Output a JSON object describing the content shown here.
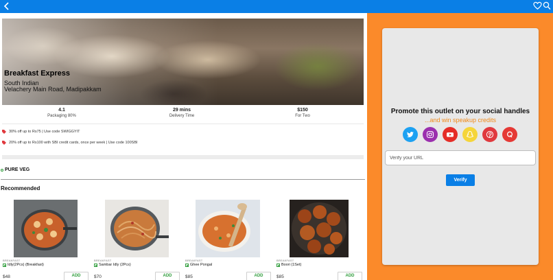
{
  "header": {
    "back_icon": "chevron-left-icon",
    "favorite_icon": "heart-icon",
    "search_icon": "search-icon",
    "color": "#0a7fe6"
  },
  "restaurant": {
    "name": "Breakfast Express",
    "cuisine": "South Indian",
    "location": "Velachery Main Road, Madipakkam"
  },
  "stats": [
    {
      "value": "4.1",
      "label": "Packaging 80%"
    },
    {
      "value": "29 mins",
      "label": "Delivery Time"
    },
    {
      "value": "$150",
      "label": "For Two"
    }
  ],
  "offers": [
    "30% off up to Rs75 | Use code SWIGGYIT",
    "20% off up to Rs100 with SBI credit cards, once per week | Use code 100SBI"
  ],
  "pure_veg_label": "PURE VEG",
  "recommended_label": "Recommended",
  "menu_items": [
    {
      "category": "BREAKFAST",
      "name": "Idly(2Pcs) (Breakfast)",
      "price": "$48",
      "add_label": "ADD"
    },
    {
      "category": "BREAKFAST",
      "name": "Sambar Idly (2Pcs)",
      "price": "$70",
      "add_label": "ADD"
    },
    {
      "category": "BREAKFAST",
      "name": "Ghee Pongal",
      "price": "$85",
      "add_label": "ADD"
    },
    {
      "category": "BREAKFAST",
      "name": "Boori (1Set)",
      "price": "$85",
      "add_label": "ADD"
    }
  ],
  "promo": {
    "title": "Promote this outlet on your social handles",
    "subtitle": "...and win speakup credits",
    "social_icons": [
      {
        "name": "twitter-icon",
        "color": "#1da1f2"
      },
      {
        "name": "instagram-icon",
        "color": "#9b2fae"
      },
      {
        "name": "youtube-icon",
        "color": "#e52d27"
      },
      {
        "name": "snapchat-icon",
        "color": "#f5d53a"
      },
      {
        "name": "pinterest-icon",
        "color": "#e0393e"
      },
      {
        "name": "quora-icon",
        "color": "#e53935"
      }
    ],
    "url_placeholder": "Verify your URL",
    "verify_label": "Verify",
    "panel_color": "#fb8a2a"
  }
}
